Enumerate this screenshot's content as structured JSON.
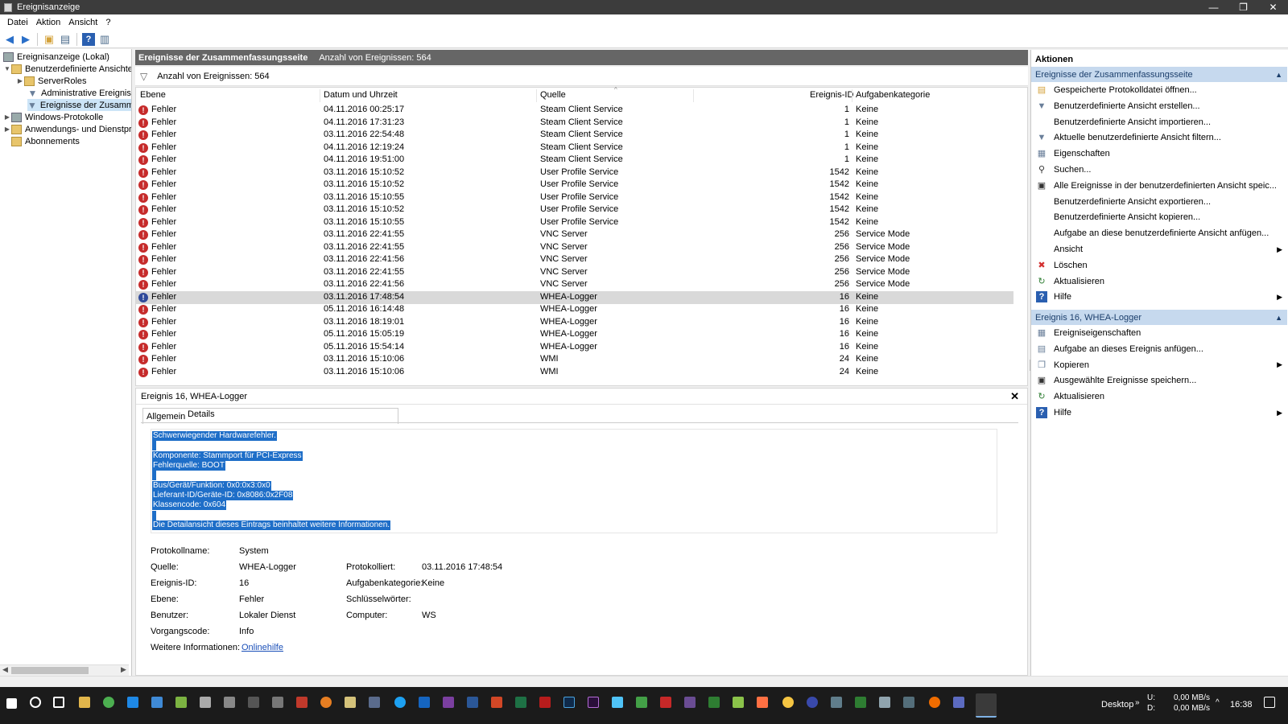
{
  "window": {
    "title": "Ereignisanzeige",
    "controls": [
      "—",
      "❐",
      "✕"
    ]
  },
  "menu": [
    "Datei",
    "Aktion",
    "Ansicht",
    "?"
  ],
  "tree": {
    "items": [
      {
        "label": "Ereignisanzeige (Lokal)",
        "icon": "computer-icon"
      },
      {
        "label": "Benutzerdefinierte Ansichten",
        "icon": "folder-icon"
      },
      {
        "label": "ServerRoles",
        "icon": "folder-icon"
      },
      {
        "label": "Administrative Ereignisse",
        "icon": "filter-icon"
      },
      {
        "label": "Ereignisse der Zusammenfassungsseite",
        "icon": "filter-icon"
      },
      {
        "label": "Windows-Protokolle",
        "icon": "computer-icon"
      },
      {
        "label": "Anwendungs- und Dienstprotokolle",
        "icon": "folder-icon"
      },
      {
        "label": "Abonnements",
        "icon": "folder-icon"
      }
    ]
  },
  "main": {
    "title": "Ereignisse der Zusammenfassungsseite",
    "count_text": "Anzahl von Ereignissen: 564",
    "filter_text": "Anzahl von Ereignissen: 564",
    "columns": [
      "Ebene",
      "Datum und Uhrzeit",
      "Quelle",
      "Ereignis-ID",
      "Aufgabenkategorie"
    ],
    "rows": [
      {
        "level": "Fehler",
        "date": "04.11.2016 00:25:17",
        "source": "Steam Client Service",
        "id": "1",
        "category": "Keine"
      },
      {
        "level": "Fehler",
        "date": "04.11.2016 17:31:23",
        "source": "Steam Client Service",
        "id": "1",
        "category": "Keine"
      },
      {
        "level": "Fehler",
        "date": "03.11.2016 22:54:48",
        "source": "Steam Client Service",
        "id": "1",
        "category": "Keine"
      },
      {
        "level": "Fehler",
        "date": "04.11.2016 12:19:24",
        "source": "Steam Client Service",
        "id": "1",
        "category": "Keine"
      },
      {
        "level": "Fehler",
        "date": "04.11.2016 19:51:00",
        "source": "Steam Client Service",
        "id": "1",
        "category": "Keine"
      },
      {
        "level": "Fehler",
        "date": "03.11.2016 15:10:52",
        "source": "User Profile Service",
        "id": "1542",
        "category": "Keine"
      },
      {
        "level": "Fehler",
        "date": "03.11.2016 15:10:52",
        "source": "User Profile Service",
        "id": "1542",
        "category": "Keine"
      },
      {
        "level": "Fehler",
        "date": "03.11.2016 15:10:55",
        "source": "User Profile Service",
        "id": "1542",
        "category": "Keine"
      },
      {
        "level": "Fehler",
        "date": "03.11.2016 15:10:52",
        "source": "User Profile Service",
        "id": "1542",
        "category": "Keine"
      },
      {
        "level": "Fehler",
        "date": "03.11.2016 15:10:55",
        "source": "User Profile Service",
        "id": "1542",
        "category": "Keine"
      },
      {
        "level": "Fehler",
        "date": "03.11.2016 22:41:55",
        "source": "VNC Server",
        "id": "256",
        "category": "Service Mode"
      },
      {
        "level": "Fehler",
        "date": "03.11.2016 22:41:55",
        "source": "VNC Server",
        "id": "256",
        "category": "Service Mode"
      },
      {
        "level": "Fehler",
        "date": "03.11.2016 22:41:56",
        "source": "VNC Server",
        "id": "256",
        "category": "Service Mode"
      },
      {
        "level": "Fehler",
        "date": "03.11.2016 22:41:55",
        "source": "VNC Server",
        "id": "256",
        "category": "Service Mode"
      },
      {
        "level": "Fehler",
        "date": "03.11.2016 22:41:56",
        "source": "VNC Server",
        "id": "256",
        "category": "Service Mode"
      },
      {
        "level": "Fehler",
        "date": "03.11.2016 17:48:54",
        "source": "WHEA-Logger",
        "id": "16",
        "category": "Keine",
        "selected": true
      },
      {
        "level": "Fehler",
        "date": "05.11.2016 16:14:48",
        "source": "WHEA-Logger",
        "id": "16",
        "category": "Keine"
      },
      {
        "level": "Fehler",
        "date": "03.11.2016 18:19:01",
        "source": "WHEA-Logger",
        "id": "16",
        "category": "Keine"
      },
      {
        "level": "Fehler",
        "date": "05.11.2016 15:05:19",
        "source": "WHEA-Logger",
        "id": "16",
        "category": "Keine"
      },
      {
        "level": "Fehler",
        "date": "05.11.2016 15:54:14",
        "source": "WHEA-Logger",
        "id": "16",
        "category": "Keine"
      },
      {
        "level": "Fehler",
        "date": "03.11.2016 15:10:06",
        "source": "WMI",
        "id": "24",
        "category": "Keine"
      },
      {
        "level": "Fehler",
        "date": "03.11.2016 15:10:06",
        "source": "WMI",
        "id": "24",
        "category": "Keine"
      }
    ]
  },
  "detail": {
    "title": "Ereignis 16, WHEA-Logger",
    "tabs": [
      "Allgemein",
      "Details"
    ],
    "description": [
      "Schwerwiegender Hardwarefehler.",
      "",
      "Komponente: Stammport für PCI-Express",
      "Fehlerquelle: BOOT",
      "",
      "Bus/Gerät/Funktion: 0x0:0x3:0x0",
      "Lieferant-ID/Geräte-ID: 0x8086:0x2F08",
      "Klassencode: 0x604",
      "",
      "Die Detailansicht dieses Eintrags beinhaltet weitere Informationen."
    ],
    "props": {
      "log_label": "Protokollname:",
      "log_value": "System",
      "source_label": "Quelle:",
      "source_value": "WHEA-Logger",
      "logged_label": "Protokolliert:",
      "logged_value": "03.11.2016 17:48:54",
      "id_label": "Ereignis-ID:",
      "id_value": "16",
      "task_label": "Aufgabenkategorie:",
      "task_value": "Keine",
      "level_label": "Ebene:",
      "level_value": "Fehler",
      "keywords_label": "Schlüsselwörter:",
      "keywords_value": "",
      "user_label": "Benutzer:",
      "user_value": "Lokaler Dienst",
      "computer_label": "Computer:",
      "computer_value": "WS",
      "opcode_label": "Vorgangscode:",
      "opcode_value": "Info",
      "moreinfo_label": "Weitere Informationen:",
      "moreinfo_link": "Onlinehilfe"
    }
  },
  "actions": {
    "title": "Aktionen",
    "section1": "Ereignisse der Zusammenfassungsseite",
    "items1": [
      {
        "label": "Gespeicherte Protokolldatei öffnen...",
        "icon": "open-icon"
      },
      {
        "label": "Benutzerdefinierte Ansicht erstellen...",
        "icon": "filter-icon"
      },
      {
        "label": "Benutzerdefinierte Ansicht importieren...",
        "icon": ""
      },
      {
        "label": "Aktuelle benutzerdefinierte Ansicht filtern...",
        "icon": "filter-icon"
      },
      {
        "label": "Eigenschaften",
        "icon": "properties-icon"
      },
      {
        "label": "Suchen...",
        "icon": "binoculars-icon"
      },
      {
        "label": "Alle Ereignisse in der benutzerdefinierten Ansicht speic...",
        "icon": "save-icon"
      },
      {
        "label": "Benutzerdefinierte Ansicht exportieren...",
        "icon": ""
      },
      {
        "label": "Benutzerdefinierte Ansicht kopieren...",
        "icon": ""
      },
      {
        "label": "Aufgabe an diese benutzerdefinierte Ansicht anfügen...",
        "icon": ""
      },
      {
        "label": "Ansicht",
        "icon": "",
        "submenu": true
      },
      {
        "label": "Löschen",
        "icon": "delete-icon"
      },
      {
        "label": "Aktualisieren",
        "icon": "refresh-icon"
      },
      {
        "label": "Hilfe",
        "icon": "help-icon",
        "submenu": true
      }
    ],
    "section2": "Ereignis 16, WHEA-Logger",
    "items2": [
      {
        "label": "Ereigniseigenschaften",
        "icon": "properties-icon"
      },
      {
        "label": "Aufgabe an dieses Ereignis anfügen...",
        "icon": "task-icon"
      },
      {
        "label": "Kopieren",
        "icon": "copy-icon",
        "submenu": true
      },
      {
        "label": "Ausgewählte Ereignisse speichern...",
        "icon": "save-icon"
      },
      {
        "label": "Aktualisieren",
        "icon": "refresh-icon"
      },
      {
        "label": "Hilfe",
        "icon": "help-icon",
        "submenu": true
      }
    ]
  },
  "taskbar": {
    "desktop": "Desktop",
    "drive_u": "U:",
    "drive_d": "D:",
    "net_up": "0,00 MB/s",
    "net_down": "0,00 MB/s",
    "time": "16:38"
  },
  "colors": {
    "titlebar": "#3c3c3c",
    "header": "#666666",
    "selection": "#1e6ec8",
    "error": "#c62b2b",
    "section": "#c6d9ee"
  }
}
